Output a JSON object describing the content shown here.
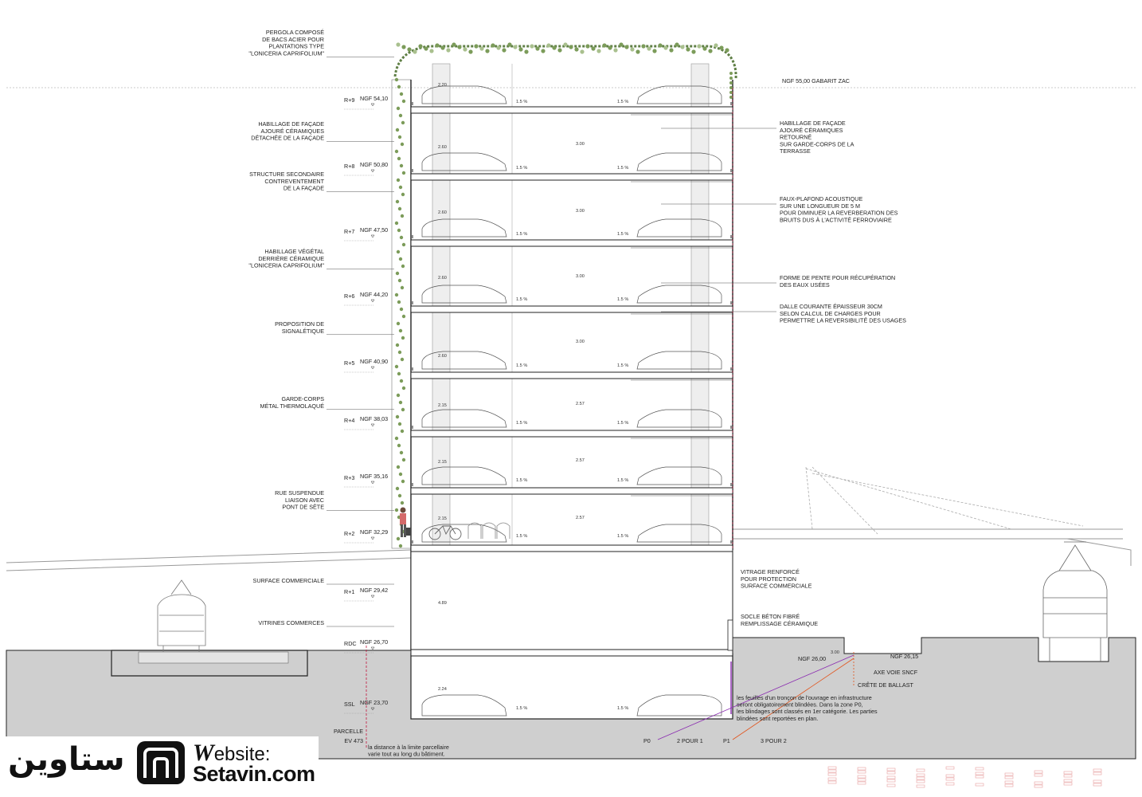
{
  "annotations_left": [
    {
      "id": "pergola",
      "lines": [
        "PERGOLA COMPOSÉ",
        "DE BACS ACIER POUR",
        "PLANTATIONS TYPE",
        "\"LONICERIA CAPRIFOLIUM\""
      ]
    },
    {
      "id": "habillage-facade",
      "lines": [
        "HABILLAGE DE FAÇADE",
        "AJOURÉ CÉRAMIQUES",
        "DÉTACHÉE DE LA FAÇADE"
      ]
    },
    {
      "id": "structure",
      "lines": [
        "STRUCTURE SECONDAIRE",
        "CONTREVENTEMENT",
        "DE LA FAÇADE"
      ]
    },
    {
      "id": "vegetal",
      "lines": [
        "HABILLAGE VÉGÉTAL",
        "DERRIÈRE CÉRAMIQUE",
        "\"LONICERIA CAPRIFOLIUM\""
      ]
    },
    {
      "id": "signaletique",
      "lines": [
        "PROPOSITION DE",
        "SIGNALÉTIQUE"
      ]
    },
    {
      "id": "garde-corps",
      "lines": [
        "GARDE-CORPS",
        "MÉTAL THERMOLAQUÉ"
      ]
    },
    {
      "id": "rue",
      "lines": [
        "RUE SUSPENDUE",
        "LIAISON AVEC",
        "PONT DE SÈTE"
      ]
    },
    {
      "id": "surface",
      "lines": [
        "SURFACE COMMERCIALE"
      ]
    },
    {
      "id": "vitrines",
      "lines": [
        "VITRINES COMMERCES"
      ]
    }
  ],
  "annotations_right": [
    {
      "id": "gabarit",
      "lines": [
        "NGF 55,00 GABARIT ZAC"
      ]
    },
    {
      "id": "habillage-retourne",
      "lines": [
        "HABILLAGE DE FAÇADE",
        "AJOURÉ CÉRAMIQUES",
        "RETOURNÉ",
        "SUR GARDE-CORPS DE LA",
        "TERRASSE"
      ]
    },
    {
      "id": "faux-plafond",
      "lines": [
        "FAUX-PLAFOND ACOUSTIQUE",
        "SUR UNE LONGUEUR DE 5 M",
        "POUR DIMINUER LA REVERBERATION DES",
        "BRUITS DUS À L'ACTIVITÉ FERROVIAIRE"
      ]
    },
    {
      "id": "pente",
      "lines": [
        "FORME DE PENTE POUR RÉCUPÉRATION",
        "DES EAUX USÉES"
      ]
    },
    {
      "id": "dalle",
      "lines": [
        "DALLE COURANTE ÉPAISSEUR 30CM",
        "SELON CALCUL DE CHARGES POUR",
        "PERMETTRE LA REVERSIBILITÉ DES USAGES"
      ]
    },
    {
      "id": "vitrage",
      "lines": [
        "VITRAGE RENFORCÉ",
        "POUR PROTECTION",
        "SURFACE COMMERCIALE"
      ]
    },
    {
      "id": "socle",
      "lines": [
        "SOCLE BÉTON FIBRÉ",
        "REMPLISSAGE CÉRAMIQUE"
      ]
    }
  ],
  "levels": [
    {
      "name": "R+9",
      "ngf": "NGF 54,10"
    },
    {
      "name": "R+8",
      "ngf": "NGF 50,80"
    },
    {
      "name": "R+7",
      "ngf": "NGF 47,50"
    },
    {
      "name": "R+6",
      "ngf": "NGF 44,20"
    },
    {
      "name": "R+5",
      "ngf": "NGF 40,90"
    },
    {
      "name": "R+4",
      "ngf": "NGF 38,03"
    },
    {
      "name": "R+3",
      "ngf": "NGF 35,16"
    },
    {
      "name": "R+2",
      "ngf": "NGF 32,29"
    },
    {
      "name": "R+1",
      "ngf": "NGF 29,42"
    },
    {
      "name": "RDC",
      "ngf": "NGF 26,70"
    },
    {
      "name": "SSL",
      "ngf": "NGF 23,70"
    }
  ],
  "floor_heights": {
    "small": [
      "2.20",
      "2.60",
      "2.60",
      "2.60",
      "2.60",
      "2.15",
      "2.15",
      "2.15",
      "4.89",
      "2.24"
    ],
    "center": [
      "3.00",
      "3.00",
      "3.00",
      "3.00",
      "2.57",
      "2.57",
      "2.57"
    ]
  },
  "slope": "1.5 %",
  "ground": {
    "ngf_26_00": "NGF 26,00",
    "ngf_26_15": "NGF 26,15",
    "dim_3_00": "3.00",
    "axe": "AXE VOIE SNCF",
    "crete": "CRÊTE DE BALLAST"
  },
  "note_blindage": [
    "les feuilles d'un tronçon de l'ouvrage en infrastructure",
    "seront obligatoirement blindées. Dans la zone P0,",
    "les blindages sont classés en 1er catégorie. Les parties",
    "blindées sont reportées en plan."
  ],
  "zones": {
    "p0": "P0",
    "p0_label": "2 POUR 1",
    "p1": "P1",
    "p1_label": "3 POUR 2"
  },
  "parcelle": {
    "title": "PARCELLE",
    "ref": "EV 473",
    "note": [
      "la distance à la limite parcellaire",
      "varie tout au long du bâtiment."
    ]
  },
  "logo": {
    "fa": "ستاوین",
    "website_w": "W",
    "website_rest": "ebsite:",
    "url": "Setavin.com"
  },
  "colors": {
    "purple": "#8a2bb0",
    "orange": "#e2531b",
    "red": "#c0143c",
    "green": "#5f7f45",
    "ground": "#cfcfcf"
  }
}
